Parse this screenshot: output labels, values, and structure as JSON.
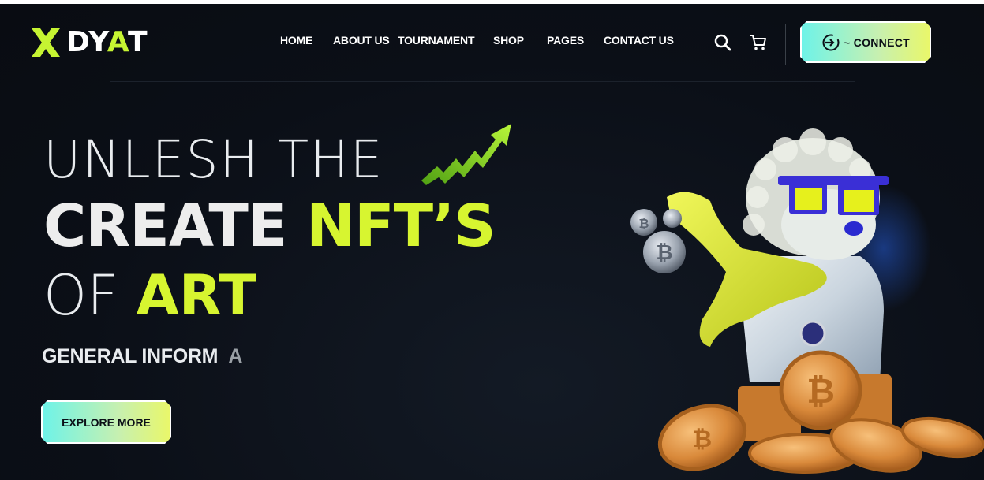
{
  "brand": {
    "name_prefix": "DY",
    "name_accent": "A",
    "name_suffix": "T"
  },
  "nav": {
    "items": [
      {
        "label": "HOME"
      },
      {
        "label": "ABOUT US"
      },
      {
        "label": "TOURNAMENT"
      },
      {
        "label": "SHOP"
      },
      {
        "label": "PAGES"
      },
      {
        "label": "CONTACT US"
      }
    ]
  },
  "header": {
    "connect_label": "~ CONNECT",
    "search_icon": "search-icon",
    "cart_icon": "cart-icon"
  },
  "hero": {
    "line1": "UNLESH THE",
    "line2_prefix": "CREATE ",
    "line2_accent": "NFT’S",
    "line3_prefix": "OF ",
    "line3_accent": "ART",
    "subhead_main": "GENERAL INFORM",
    "subhead_dim": "A",
    "cta_label": "EXPLORE MORE"
  },
  "colors": {
    "background": "#0b0f17",
    "accent": "#d7f530",
    "button_gradient_start": "#6ef3e8",
    "button_gradient_end": "#e9f76a"
  }
}
